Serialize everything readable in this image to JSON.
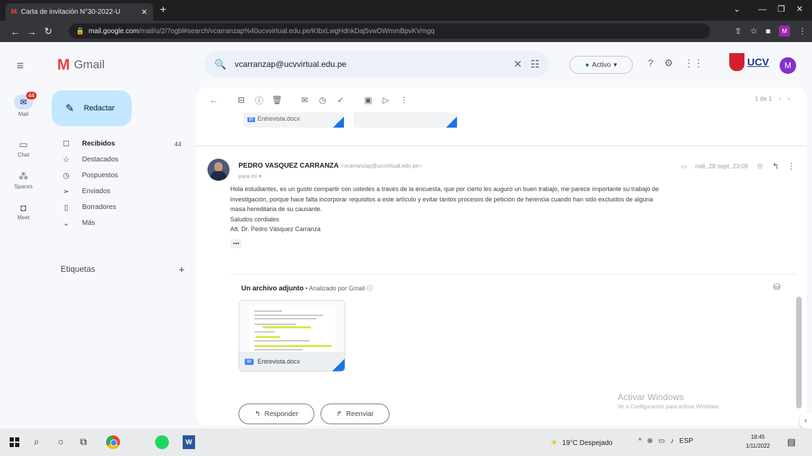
{
  "browser": {
    "tab_title": "Carta de invitación N°30-2022-U",
    "tab_favicon": "M",
    "url_domain": "mail.google.com",
    "url_path": "/mail/u/2/?ogbl#search/vcarranzap%40ucvvirtual.edu.pe/KtbxLwgHdnkDaj5vwDWmmBpvKVmgq"
  },
  "gmail": {
    "logo_word": "Gmail",
    "search_value": "vcarranzap@ucvvirtual.edu.pe",
    "status": "Activo",
    "avatar_letter": "M",
    "org_logo_text": "UCV"
  },
  "rail": {
    "mail_label": "Mail",
    "mail_badge": "44",
    "chat_label": "Chat",
    "spaces_label": "Spaces",
    "meet_label": "Meet"
  },
  "nav": {
    "compose": "Redactar",
    "items": [
      {
        "label": "Recibidos",
        "count": "44"
      },
      {
        "label": "Destacados"
      },
      {
        "label": "Pospuestos"
      },
      {
        "label": "Enviados"
      },
      {
        "label": "Borradores"
      },
      {
        "label": "Más"
      }
    ],
    "labels_heading": "Etiquetas"
  },
  "thread": {
    "pager": "1 de 1",
    "prev_attachment": "Entrevista.docx",
    "sender_name": "PEDRO VASQUEZ CARRANZA",
    "sender_email": "<vcarranzap@ucvvirtual.edu.pe>",
    "to_line": "para mí",
    "date": "mié, 28 sept, 23:09",
    "body": [
      "Hola estudiantes, es un gusto compartir con ustedes a través de la encuesta, que por cierto les auguro un buen trabajo, me parece importante su trabajo de",
      "investigación, porque hace falta incorporar requisitos a este artículo y evitar tantos procesos de petición de herencia cuando han sido excluidos de alguna",
      "masa hereditaria de su causante.",
      "Saludos cordiales",
      "Att. Dr. Pedro Vásquez Carranza"
    ],
    "ellipsis": "•••",
    "attachments_title": "Un archivo adjunto",
    "attachments_scan": " • Analizado por Gmail ⓘ",
    "attachment_name": "Entrevista.docx",
    "reply_label": "Responder",
    "forward_label": "Reenviar"
  },
  "watermark": {
    "line1": "Activar Windows",
    "line2": "Ve a Configuración para activar Windows."
  },
  "taskbar": {
    "weather": "19°C  Despejado",
    "lang": "ESP",
    "time": "18:45",
    "date": "1/11/2022"
  }
}
